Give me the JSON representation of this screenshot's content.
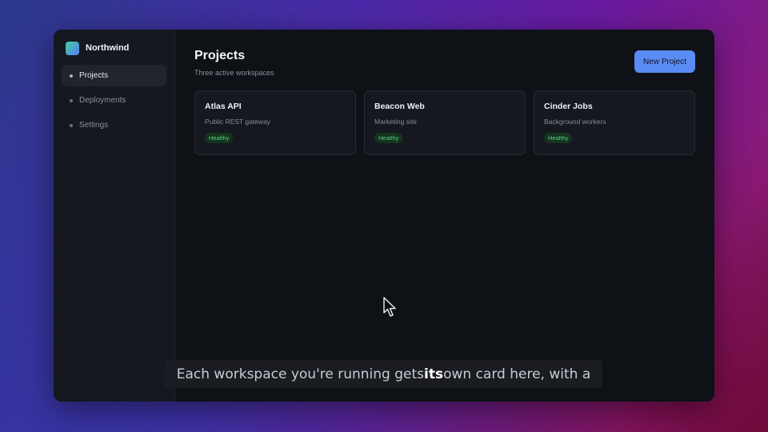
{
  "brand": {
    "name": "Northwind"
  },
  "sidebar": {
    "items": [
      {
        "label": "Projects",
        "active": true
      },
      {
        "label": "Deployments",
        "active": false
      },
      {
        "label": "Settings",
        "active": false
      }
    ]
  },
  "header": {
    "title": "Projects",
    "subtitle": "Three active workspaces",
    "new_project_label": "New Project"
  },
  "cards": [
    {
      "title": "Atlas API",
      "description": "Public REST gateway",
      "status": "Healthy"
    },
    {
      "title": "Beacon Web",
      "description": "Marketing site",
      "status": "Healthy"
    },
    {
      "title": "Cinder Jobs",
      "description": "Background workers",
      "status": "Healthy"
    }
  ],
  "caption": {
    "before": "Each workspace you're running gets ",
    "highlight": "its",
    "after": " own card here, with a"
  },
  "colors": {
    "accent": "#5b8cf5",
    "status_healthy": "#4fd57f",
    "window_bg": "#0e1116"
  },
  "icons": {
    "brand": "brand-logo-icon",
    "cursor": "mouse-pointer-icon"
  }
}
